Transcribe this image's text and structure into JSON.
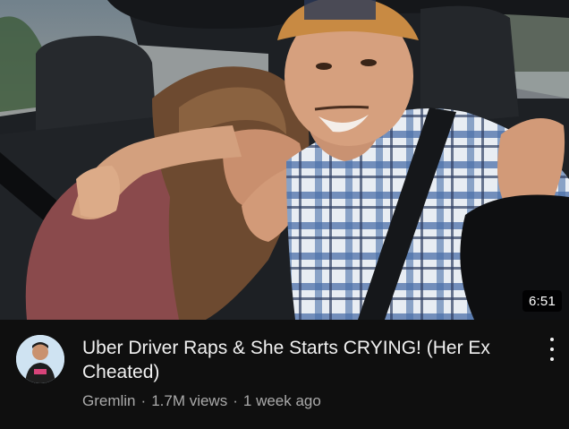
{
  "video": {
    "title": "Uber Driver Raps & She Starts CRYING! (Her Ex Cheated)",
    "duration": "6:51",
    "channel": "Gremlin",
    "views": "1.7M views",
    "separator": "·",
    "uploaded": "1 week ago"
  },
  "icons": {
    "more": "vertical-ellipsis-icon",
    "avatar": "channel-avatar"
  },
  "colors": {
    "background": "#0f0f0f",
    "title_text": "#f1f1f1",
    "meta_text": "#aaaaaa",
    "duration_bg": "#000000"
  }
}
